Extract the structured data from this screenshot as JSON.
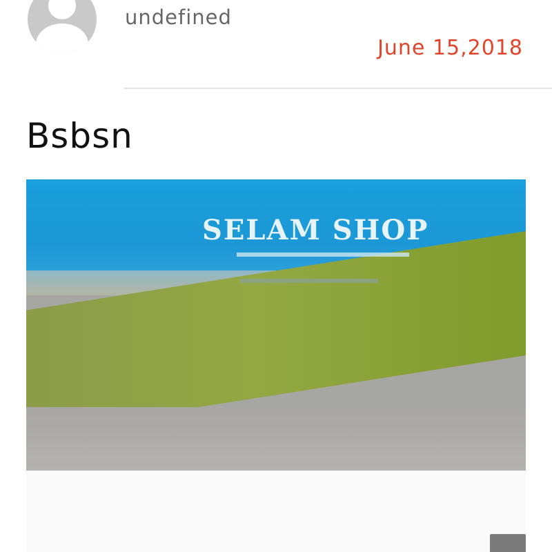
{
  "post": {
    "author": "undefined",
    "date": "June 15,2018",
    "title": "Bsbsn",
    "image": {
      "text": "SELAM SHOP"
    }
  },
  "colors": {
    "date": "#e0452b",
    "author": "#666666",
    "title": "#111111",
    "divider": "#e3e3e3",
    "avatar": "#c9c9c9"
  },
  "icons": {
    "avatar": "default-user-avatar-icon"
  }
}
